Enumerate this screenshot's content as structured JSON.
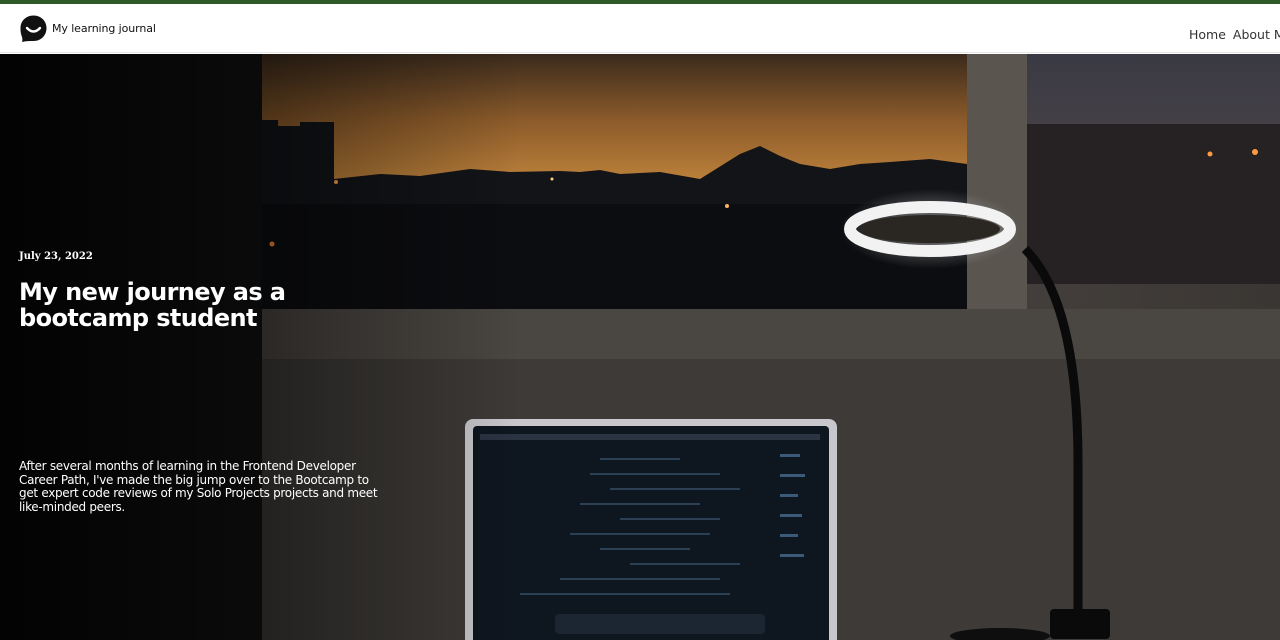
{
  "header": {
    "brand_name": "My learning journal",
    "nav": [
      {
        "label": "Home"
      },
      {
        "label": "About Me"
      }
    ]
  },
  "hero": {
    "date": "July 23, 2022",
    "title": "My new journey as a bootcamp student",
    "excerpt": "After several months of learning in the Frontend Developer Career Path, I've made the big jump over to the Bootcamp to get expert code reviews of my Solo Projects projects and meet like-minded peers."
  },
  "colors": {
    "accent_bar": "#2d5a27",
    "header_bg": "#ffffff",
    "hero_text": "#ffffff"
  },
  "icons": [
    "chat-logo-icon"
  ]
}
